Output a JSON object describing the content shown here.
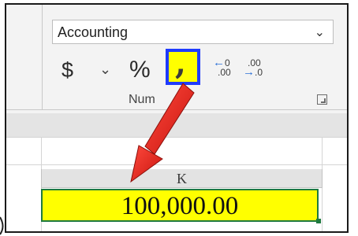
{
  "ribbon": {
    "number_format": {
      "selected": "Accounting",
      "chevron_icon": "chevron-down-icon"
    },
    "buttons": {
      "currency": "$",
      "currency_dropdown": "˜",
      "percent": "%",
      "comma_style": "❜",
      "increase_decimal": {
        "top": "←0",
        "bottom": ".00"
      },
      "decrease_decimal": {
        "top": ".00",
        "bottom": "→.0"
      }
    },
    "group_label": "Num",
    "highlight_colors": {
      "comma_button_fill": "#ffff00",
      "comma_button_border": "#1f3bff"
    }
  },
  "sheet": {
    "column_header": "K",
    "selected_cell": {
      "value": "100,000.00",
      "fill": "#ffff00",
      "border": "#1f7a3f"
    }
  },
  "annotation": {
    "arrow_color": "#e0201b"
  }
}
